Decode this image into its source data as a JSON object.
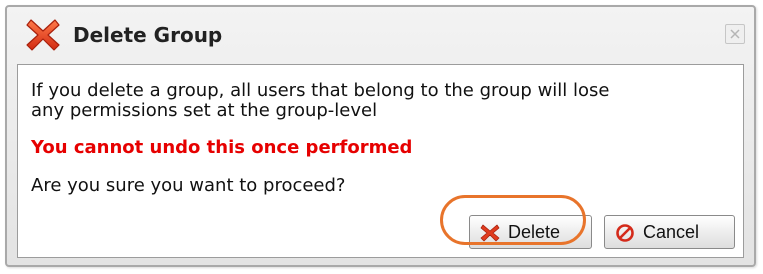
{
  "dialog": {
    "title": "Delete Group",
    "title_icon": "red-x-icon",
    "close_icon": "close-icon",
    "message_line1": "If you delete a group, all users that belong to the group will lose",
    "message_line2": "any permissions set at the group-level",
    "warning": "You cannot undo this once performed",
    "question": "Are you sure you want to proceed?",
    "delete_label": "Delete",
    "delete_icon": "red-x-icon",
    "cancel_label": "Cancel",
    "cancel_icon": "no-entry-icon"
  },
  "colors": {
    "warning_text": "#e60000",
    "highlight": "#e8742b",
    "icon_red": "#e03c1f"
  }
}
